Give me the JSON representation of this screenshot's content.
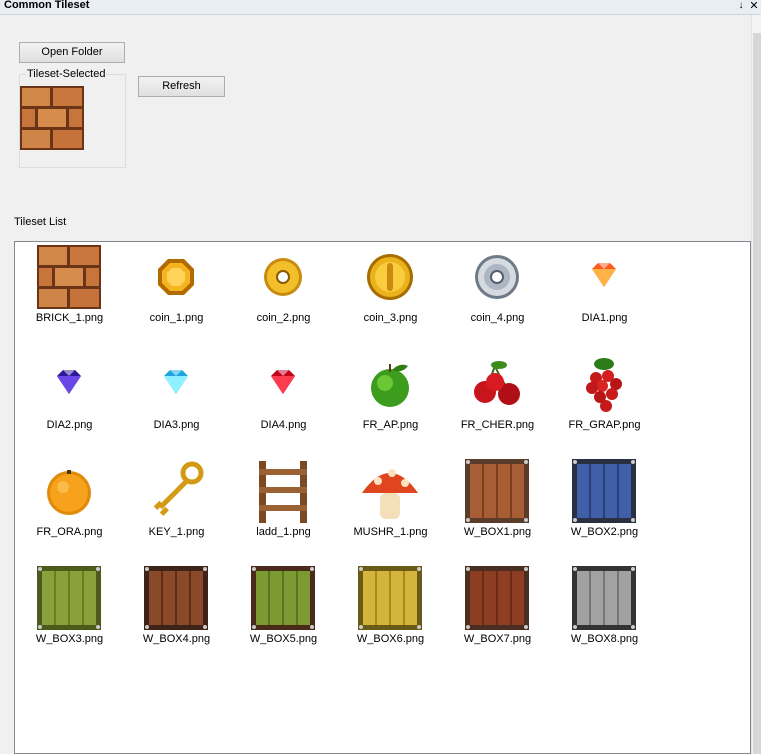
{
  "window": {
    "title": "Common Tileset",
    "pin_glyph": "↓",
    "close_glyph": "✕"
  },
  "toolbar": {
    "open_folder_label": "Open Folder",
    "refresh_label": "Refresh"
  },
  "selected": {
    "group_label": "Tileset-Selected",
    "tile_icon": "brick-tile"
  },
  "list": {
    "label": "Tileset List",
    "items": [
      {
        "name": "BRICK_1.png",
        "icon": "brick"
      },
      {
        "name": "coin_1.png",
        "icon": "coin-octagon"
      },
      {
        "name": "coin_2.png",
        "icon": "coin-ring"
      },
      {
        "name": "coin_3.png",
        "icon": "coin-gold"
      },
      {
        "name": "coin_4.png",
        "icon": "coin-silver"
      },
      {
        "name": "DIA1.png",
        "icon": "diamond-orange"
      },
      {
        "name": "DIA2.png",
        "icon": "diamond-blue"
      },
      {
        "name": "DIA3.png",
        "icon": "diamond-cyan"
      },
      {
        "name": "DIA4.png",
        "icon": "diamond-red"
      },
      {
        "name": "FR_AP.png",
        "icon": "apple"
      },
      {
        "name": "FR_CHER.png",
        "icon": "cherry"
      },
      {
        "name": "FR_GRAP.png",
        "icon": "grape"
      },
      {
        "name": "FR_ORA.png",
        "icon": "orange"
      },
      {
        "name": "KEY_1.png",
        "icon": "key"
      },
      {
        "name": "ladd_1.png",
        "icon": "ladder"
      },
      {
        "name": "MUSHR_1.png",
        "icon": "mushroom"
      },
      {
        "name": "W_BOX1.png",
        "icon": "box-brown"
      },
      {
        "name": "W_BOX2.png",
        "icon": "box-blue"
      },
      {
        "name": "W_BOX3.png",
        "icon": "box-green"
      },
      {
        "name": "W_BOX4.png",
        "icon": "box-dark"
      },
      {
        "name": "W_BOX5.png",
        "icon": "box-olive"
      },
      {
        "name": "W_BOX6.png",
        "icon": "box-yellow"
      },
      {
        "name": "W_BOX7.png",
        "icon": "box-redbrown"
      },
      {
        "name": "W_BOX8.png",
        "icon": "box-gray"
      }
    ]
  },
  "colors": {
    "brick": "#c87a3f",
    "brick_dark": "#6b3416",
    "gold": "#e8a612",
    "gold_light": "#ffd45a",
    "silver": "#c9ced6",
    "box_brown": "#a85e34",
    "box_blue": "#3f5fa8",
    "box_green": "#8aa03a",
    "box_dark": "#6e3a22",
    "box_olive": "#7b9a32",
    "box_yellow": "#d2b53a",
    "box_redbrown": "#8c3d22",
    "box_gray": "#a2a2a2"
  }
}
